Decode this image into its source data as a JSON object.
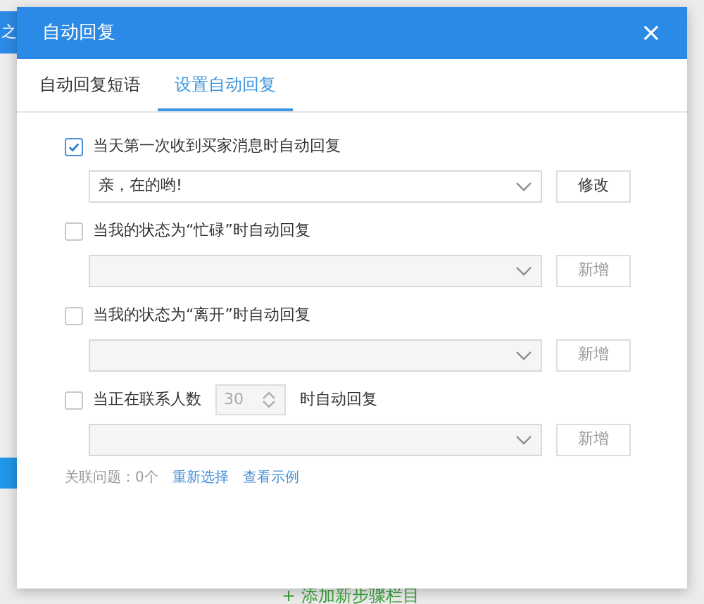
{
  "background": {
    "fragments": [
      "之"
    ],
    "footer_link": "+ 添加新步骤栏目"
  },
  "dialog": {
    "title": "自动回复",
    "close": "×",
    "tabs": [
      {
        "label": "自动回复短语",
        "selected": false
      },
      {
        "label": "设置自动回复",
        "selected": true
      }
    ],
    "rules": [
      {
        "kind": "text",
        "checked": true,
        "label": "当天第一次收到买家消息时自动回复",
        "value": "亲，在的哟!",
        "button": "修改"
      },
      {
        "kind": "text",
        "checked": false,
        "label": "当我的状态为“忙碌”时自动回复",
        "button": "新增"
      },
      {
        "kind": "text",
        "checked": false,
        "label": "当我的状态为“离开”时自动回复",
        "button": "新增"
      },
      {
        "kind": "count",
        "checked": false,
        "label": "当正在联系人数",
        "count": "30",
        "suffix": "时自动回复",
        "button": "新增"
      }
    ],
    "footer": {
      "text": "关联问题：0个",
      "links": [
        "重新选择",
        "查看示例"
      ]
    }
  }
}
